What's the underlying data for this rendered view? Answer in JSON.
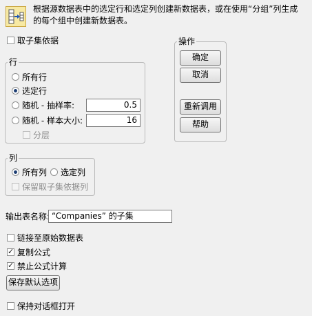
{
  "header": {
    "icon": "subset-table-icon",
    "description_line1": "根据源数据表中的选定行和选定列创建新数据表，或在使用“分组”列生成",
    "description_line2": "的每个组中创建新数据表。"
  },
  "take_subset_by": {
    "label": "取子集依据",
    "checked": false
  },
  "rows_group": {
    "title": "行",
    "all_rows": {
      "label": "所有行",
      "selected": false
    },
    "selected_rows": {
      "label": "选定行",
      "selected": true
    },
    "random_sampling_rate": {
      "label": "随机 - 抽样率:",
      "value": "0.5",
      "selected": false
    },
    "random_sample_size": {
      "label": "随机 - 样本大小:",
      "value": "16",
      "selected": false
    },
    "stratify": {
      "label": "分层",
      "checked": false,
      "enabled": false
    }
  },
  "actions_group": {
    "title": "操作",
    "ok": "确定",
    "cancel": "取消",
    "recall": "重新调用",
    "help": "帮助"
  },
  "columns_group": {
    "title": "列",
    "all_columns": {
      "label": "所有列",
      "selected": true
    },
    "selected_columns": {
      "label": "选定列",
      "selected": false
    },
    "keep_by_columns": {
      "label": "保留取子集依据列",
      "checked": false,
      "enabled": false
    }
  },
  "output_table": {
    "label": "输出表名称:",
    "value": "“Companies” 的子集"
  },
  "options": {
    "link_to_original": {
      "label": "链接至原始数据表",
      "checked": false
    },
    "copy_formula": {
      "label": "复制公式",
      "checked": true
    },
    "suppress_formula_eval": {
      "label": "禁止公式计算",
      "checked": true
    },
    "save_defaults_button": "保存默认选项",
    "keep_dialog_open": {
      "label": "保持对话框打开",
      "checked": false
    }
  }
}
